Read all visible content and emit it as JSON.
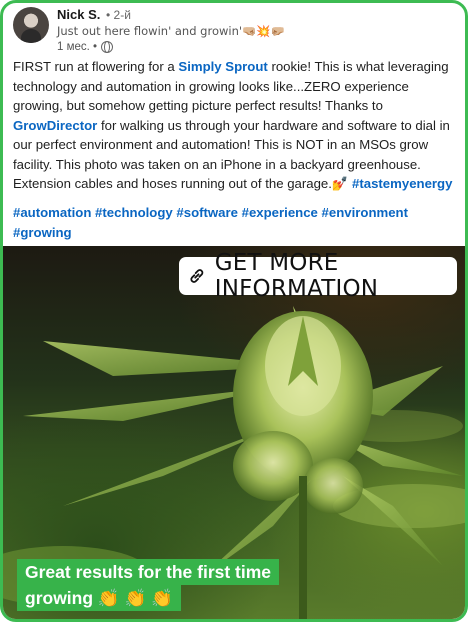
{
  "author": {
    "name": "Nick S.",
    "degree": "• 2-й",
    "tagline": "Just out here flowin' and growin'🤜🏼💥🤛🏼",
    "time": "1 мес. •",
    "visibility_icon": "globe-icon"
  },
  "post": {
    "p1_a": "FIRST run at flowering for a ",
    "p1_link": "Simply Sprout",
    "p1_b": " rookie! This is what leveraging technology and automation in growing looks like...ZERO experience growing, but somehow getting picture perfect results! Thanks to ",
    "p1_link2": "GrowDirector",
    "p1_c": " for walking us through your hardware and software to dial in our perfect environment and automation! This is NOT in an MSOs grow facility. This photo was taken on an iPhone in a backyard greenhouse. Extension cables and hoses running out of the garage.",
    "p1_emoji": "💅",
    "p1_tag": "#tastemyenergy",
    "hashtags": "#automation #technology #software #experience #environment #growing"
  },
  "image": {
    "cta_label": "GET MORE INFORMATION",
    "caption_line1": "Great results for the first time",
    "caption_line2": "growing 👏 👏 👏"
  },
  "colors": {
    "frame": "#3dbb52",
    "link": "#0a66c2",
    "caption_bg": "#37b34a"
  }
}
